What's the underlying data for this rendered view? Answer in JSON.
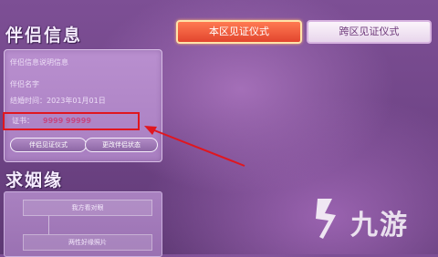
{
  "left_panel": {
    "partner_title": "伴侣信息",
    "info_lines": [
      "伴侣信息说明信息",
      "伴侣名字",
      "结婚时间：2023年01月01日"
    ],
    "cert_label": "证书：",
    "cert_value": "9999 99999",
    "buttons": [
      "伴侣见证仪式",
      "更改伴侣状态"
    ],
    "seek_title": "求姻缘",
    "seek_items": [
      "我方看对眼",
      "两性好缘照片"
    ]
  },
  "tabs": {
    "local": "本区见证仪式",
    "cross": "跨区见证仪式"
  },
  "watermark": {
    "text": "九游"
  },
  "colors": {
    "highlight": "#e0161f",
    "active_tab": "#e2452e"
  }
}
